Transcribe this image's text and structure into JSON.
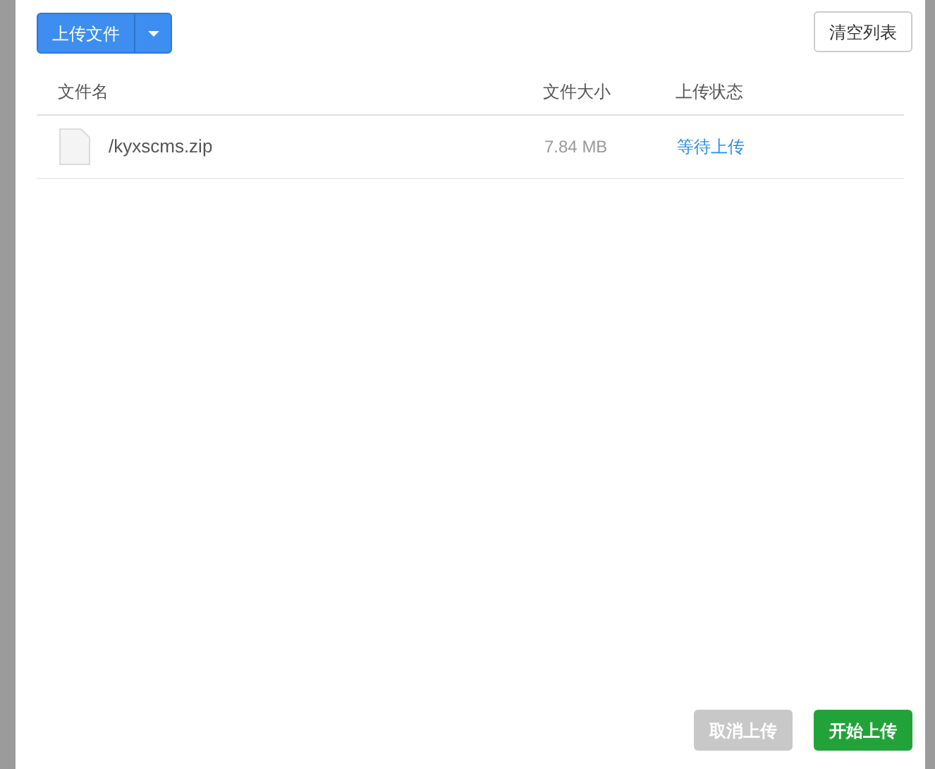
{
  "toolbar": {
    "upload_button": "上传文件",
    "clear_button": "清空列表"
  },
  "table": {
    "columns": [
      "文件名",
      "文件大小",
      "上传状态"
    ],
    "rows": [
      {
        "name": "/kyxscms.zip",
        "size": "7.84 MB",
        "status": "等待上传"
      }
    ]
  },
  "footer": {
    "buttons": [
      {
        "label": "取消上传",
        "kind": "cancel",
        "disabled": true
      },
      {
        "label": "开始上传",
        "kind": "start",
        "disabled": false
      }
    ]
  }
}
